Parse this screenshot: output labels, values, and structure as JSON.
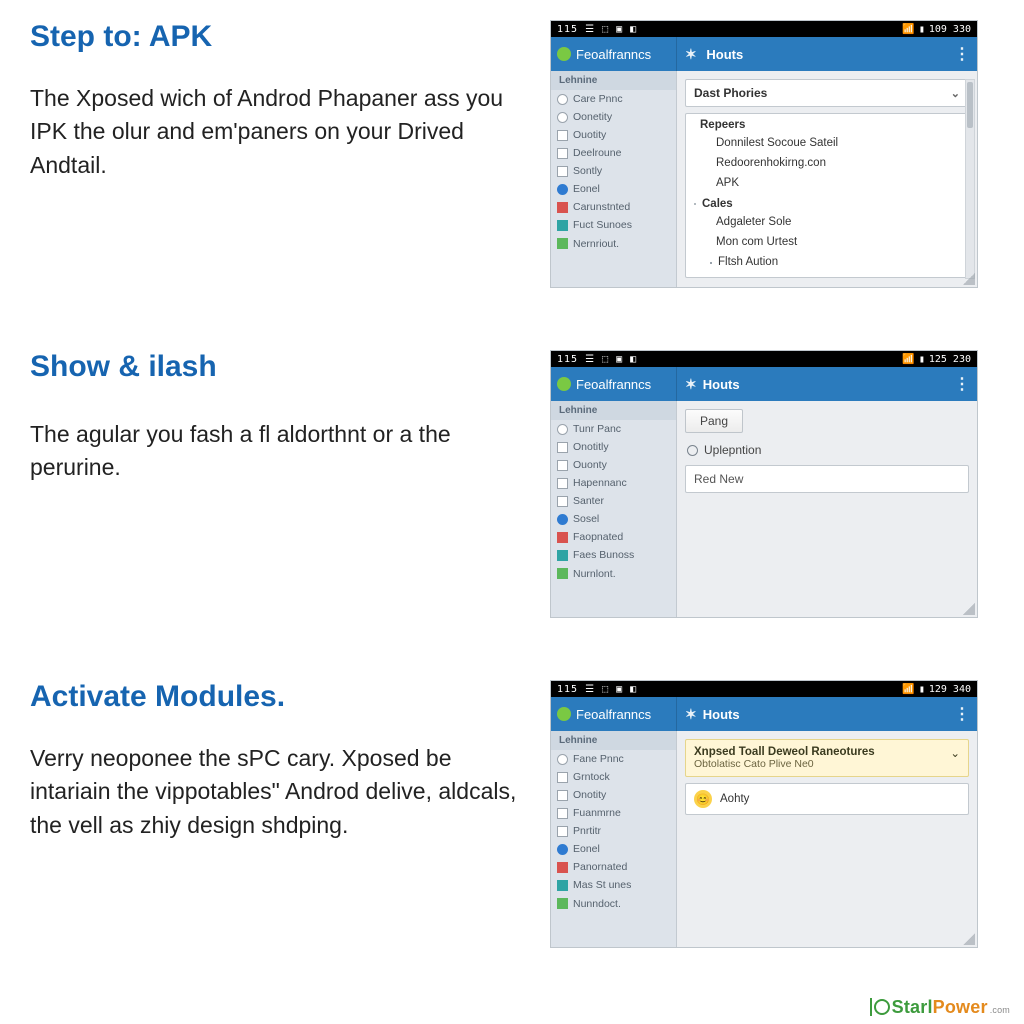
{
  "sections": [
    {
      "heading": "Step to: APK",
      "body": "The Xposed wich of Androd Phapaner ass you IPK the olur and em'paners on your Drived Andtail."
    },
    {
      "heading": "Show & ilash",
      "body": "The agular you fash a fl aldorthnt or a the perurine."
    },
    {
      "heading": "Activate Modules.",
      "body": "Verry neoponee the sPC cary. Xposed be intariain the vippotables\" Androd delive, aldcals, the vell as zhiy design shdping."
    }
  ],
  "status": {
    "left": "115 ☰ ⬚ ▣ ◧",
    "time1": "109 330",
    "time2": "125 230",
    "time3": "129 340",
    "batt": "▮",
    "wifi": "📶"
  },
  "app": {
    "left_title": "Feoalfranncs",
    "right_back": "✶",
    "right_title": "Houts",
    "kebab": "⋮"
  },
  "sidebar_header": "Lehnine",
  "sidebar_items_variant_a": [
    "Care Pnnc",
    "Oonetity",
    "Ouotity",
    "Deelroune",
    "Sontly",
    "Eonel",
    "Carunstnted",
    "Fuct Sunoes",
    "Nernriout."
  ],
  "sidebar_items_variant_b": [
    "Tunr Panc",
    "Onotitly",
    "Ouonty",
    "Hapennanc",
    "Santer",
    "Sosel",
    "Faopnated",
    "Faes Bunoss",
    "Nurnlont."
  ],
  "sidebar_items_variant_c": [
    "Fane Pnnc",
    "Grntock",
    "Onotity",
    "Fuanmrne",
    "Pnrtitr",
    "Eonel",
    "Panornated",
    "Mas St unes",
    "Nunndoct."
  ],
  "panel1": {
    "chip": "Dast Phories",
    "group1": "Repeers",
    "g1_items": [
      "Donnilest Socoue Sateil",
      "Redoorenhokirng.con",
      "APK"
    ],
    "group2": "Cales",
    "g2_items": [
      "Adgaleter Sole",
      "Mon com Urtest",
      "Fltsh Aution"
    ]
  },
  "panel2": {
    "button": "Pang",
    "radio": "Uplepntion",
    "field": "Red New"
  },
  "panel3": {
    "notice_title": "Xnpsed Toall Deweol Raneotures",
    "notice_sub": "Obtolatisc Cato Plive Ne0",
    "entry": "Aohty"
  },
  "footer": {
    "left": "Starl",
    "right": "Power",
    "com": ".com"
  }
}
